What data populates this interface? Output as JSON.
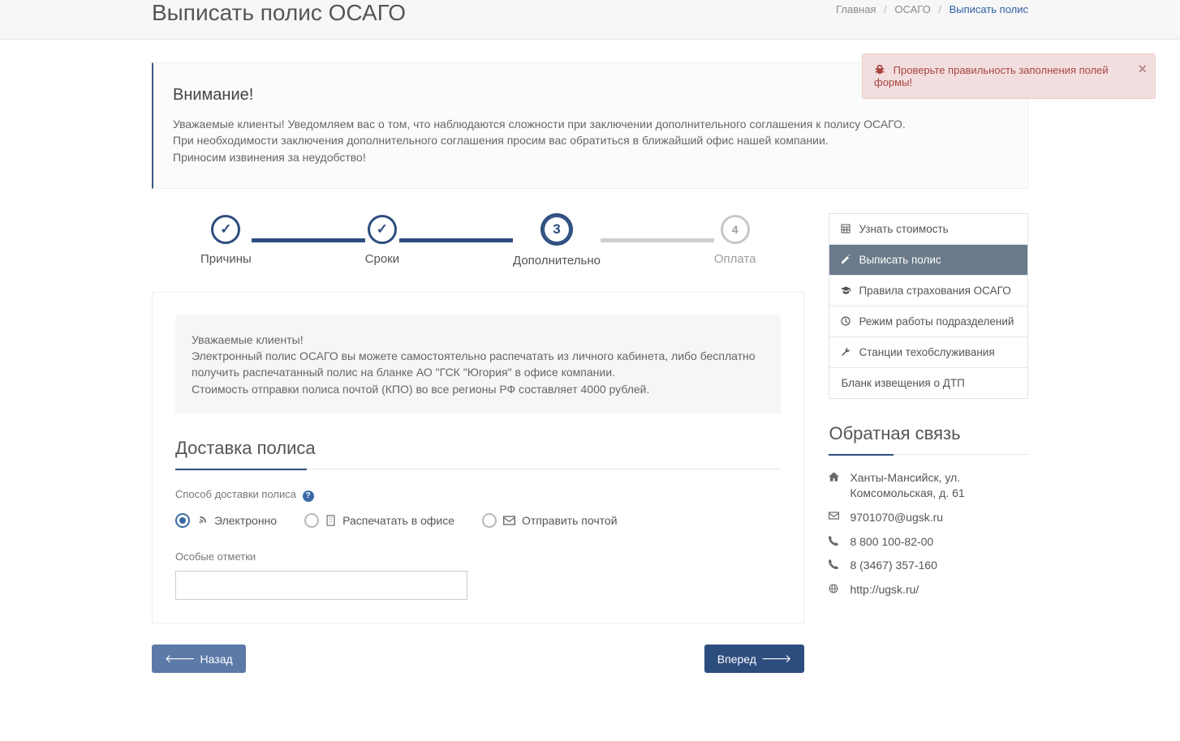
{
  "page": {
    "title": "Выписать полис ОСАГО",
    "breadcrumb": {
      "home": "Главная",
      "cat": "ОСАГО",
      "current": "Выписать полис"
    }
  },
  "toast": {
    "text": "Проверьте правильность заполнения полей формы!"
  },
  "attention": {
    "title": "Внимание!",
    "line1": "Уважаемые клиенты! Уведомляем вас о том, что наблюдаются сложности при заключении дополнительного соглашения к полису ОСАГО.",
    "line2": "При необходимости заключения дополнительного соглашения просим вас обратиться в ближайший офис нашей компании.",
    "line3": "Приносим извинения за неудобство!"
  },
  "wizard": {
    "step1": "Причины",
    "step2": "Сроки",
    "step3": "Дополнительно",
    "step4": "Оплата",
    "step3num": "3",
    "step4num": "4"
  },
  "notice": {
    "l1": "Уважаемые клиенты!",
    "l2": "Электронный полис ОСАГО вы можете самостоятельно распечатать из личного кабинета, либо бесплатно получить распечатанный полис на бланке АО \"ГСК \"Югория\" в офисе компании.",
    "l3": "Стоимость отправки полиса почтой (КПО) во все регионы РФ составляет 4000 рублей."
  },
  "form": {
    "section_title": "Доставка полиса",
    "delivery_label": "Способ доставки полиса",
    "opt_electronic": "Электронно",
    "opt_office": "Распечатать в офисе",
    "opt_post": "Отправить почтой",
    "remarks_label": "Особые отметки",
    "remarks_value": ""
  },
  "buttons": {
    "back": "Назад",
    "next": "Вперед"
  },
  "sidebar": {
    "items": {
      "0": "Узнать стоимость",
      "1": "Выписать полис",
      "2": "Правила страхования ОСАГО",
      "3": "Режим работы подразделений",
      "4": "Станции техобслуживания",
      "5": "Бланк извещения о ДТП"
    }
  },
  "feedback": {
    "title": "Обратная связь",
    "address": "Ханты-Мансийск, ул. Комсомольская, д. 61",
    "email": "9701070@ugsk.ru",
    "phone1": "8 800 100-82-00",
    "phone2": "8 (3467) 357-160",
    "url": "http://ugsk.ru/"
  }
}
